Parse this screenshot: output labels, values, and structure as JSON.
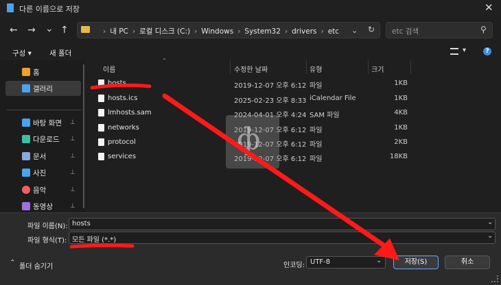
{
  "window": {
    "title": "다른 이름으로 저장",
    "close_glyph": "✕"
  },
  "nav": {
    "back": "←",
    "forward": "→",
    "recent": "⌄",
    "up": "↑"
  },
  "address": {
    "breadcrumbs": [
      "내 PC",
      "로컬 디스크 (C:)",
      "Windows",
      "System32",
      "drivers",
      "etc"
    ],
    "sep": "›"
  },
  "search": {
    "placeholder": "etc 검색"
  },
  "toolbar": {
    "organize": "구성 ▾",
    "new_folder": "새 폴더"
  },
  "sidebar": {
    "items": [
      {
        "label": "홈",
        "icon": "home-icon",
        "color": "#f0a030"
      },
      {
        "label": "갤러리",
        "icon": "gallery-icon",
        "color": "#4aa3f0"
      },
      {
        "label": "바탕 화면",
        "icon": "desktop-icon",
        "color": "#4aa3f0"
      },
      {
        "label": "다운로드",
        "icon": "download-icon",
        "color": "#3cc0a0"
      },
      {
        "label": "문서",
        "icon": "document-icon",
        "color": "#8aa8d8"
      },
      {
        "label": "사진",
        "icon": "pictures-icon",
        "color": "#4aa3f0"
      },
      {
        "label": "음악",
        "icon": "music-icon",
        "color": "#f06060"
      },
      {
        "label": "동영상",
        "icon": "videos-icon",
        "color": "#a070e0"
      }
    ],
    "pin_glyph": "📌"
  },
  "columns": {
    "name": "이름",
    "date": "수정한 날짜",
    "type": "유형",
    "size": "크기"
  },
  "files": [
    {
      "name": "hosts",
      "date": "2019-12-07 오후 6:12",
      "type": "파일",
      "size": "1KB"
    },
    {
      "name": "hosts.ics",
      "date": "2025-02-23 오후 8:33",
      "type": "iCalendar File",
      "size": "1KB"
    },
    {
      "name": "lmhosts.sam",
      "date": "2024-04-01 오후 4:24",
      "type": "SAM 파일",
      "size": "4KB"
    },
    {
      "name": "networks",
      "date": "2019-12-07 오후 6:12",
      "type": "파일",
      "size": "1KB"
    },
    {
      "name": "protocol",
      "date": "2019-12-07 오후 6:12",
      "type": "파일",
      "size": "2KB"
    },
    {
      "name": "services",
      "date": "2019-12-07 오후 6:12",
      "type": "파일",
      "size": "18KB"
    }
  ],
  "bottom": {
    "filename_label": "파일 이름(N):",
    "filename_value": "hosts",
    "filetype_label": "파일 형식(T):",
    "filetype_value": "모든 파일  (*.*)",
    "hide_folders": "폴더 숨기기",
    "encoding_label": "인코딩:",
    "encoding_value": "UTF-8",
    "save": "저장(S)",
    "cancel": "취소"
  },
  "colors": {
    "accent": "#ff1a1a",
    "save_border": "#6aa9ff",
    "background": "#1f1f1f"
  }
}
